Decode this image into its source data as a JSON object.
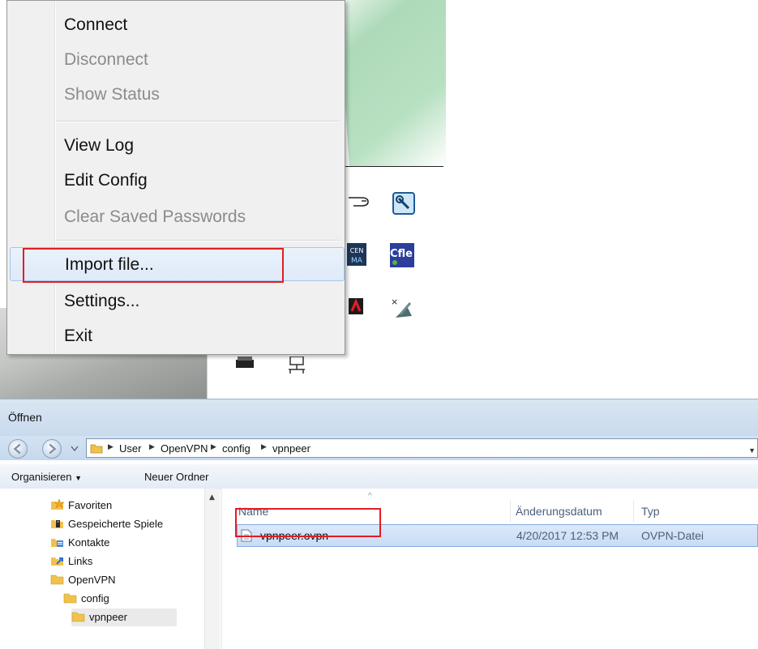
{
  "context_menu": {
    "items": [
      {
        "label": "Connect",
        "enabled": true
      },
      {
        "label": "Disconnect",
        "enabled": false
      },
      {
        "label": "Show Status",
        "enabled": false
      },
      {
        "label": "View Log",
        "enabled": true
      },
      {
        "label": "Edit Config",
        "enabled": true
      },
      {
        "label": "Clear Saved Passwords",
        "enabled": false
      },
      {
        "label": "Import file...",
        "enabled": true,
        "hovered": true,
        "highlighted": true
      },
      {
        "label": "Settings...",
        "enabled": true
      },
      {
        "label": "Exit",
        "enabled": true
      }
    ]
  },
  "desktop": {
    "icons": [
      "hand-cursor-icon",
      "wrench-settings-icon",
      "app-shortcut-icon",
      "cfile-icon",
      "adobe-icon",
      "x-tool-icon",
      "drive-icon",
      "network-icon"
    ]
  },
  "dialog": {
    "title": "Öffnen",
    "address": {
      "crumbs": [
        "User",
        "OpenVPN",
        "config",
        "vpnpeer"
      ]
    },
    "toolbar": {
      "organize_label": "Organisieren",
      "new_folder_label": "Neuer Ordner"
    },
    "nav_tree": [
      {
        "label": "Favoriten",
        "icon": "star-folder-icon"
      },
      {
        "label": "Gespeicherte Spiele",
        "icon": "saved-games-icon"
      },
      {
        "label": "Kontakte",
        "icon": "contacts-icon"
      },
      {
        "label": "Links",
        "icon": "links-icon"
      },
      {
        "label": "OpenVPN",
        "icon": "folder-icon"
      },
      {
        "label": "config",
        "icon": "folder-icon"
      },
      {
        "label": "vpnpeer",
        "icon": "folder-icon"
      }
    ],
    "columns": {
      "name": "Name",
      "date": "Änderungsdatum",
      "type": "Typ"
    },
    "files": [
      {
        "name": "vpnpeer.ovpn",
        "date": "4/20/2017 12:53 PM",
        "type": "OVPN-Datei",
        "selected": true
      }
    ]
  },
  "colors": {
    "highlight_red": "#e31c23",
    "selection_blue": "#c8dcf4",
    "titlebar_blue": "#c8daed"
  }
}
